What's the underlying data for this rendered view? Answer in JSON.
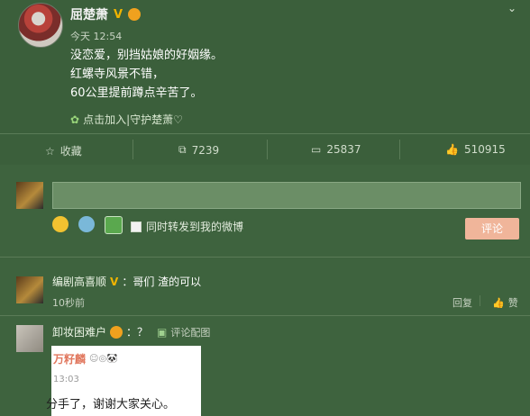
{
  "post": {
    "username": "屈楚萧",
    "verified": "V",
    "time": "今天 12:54",
    "lines": [
      "没恋爱，别挡姑娘的好姻缘。",
      "红螺寺风景不错，",
      "60公里提前蹲点辛苦了。"
    ],
    "guard_link": "点击加入|守护楚萧♡"
  },
  "actions": {
    "favorite": "收藏",
    "repost": "7239",
    "comment": "25837",
    "like": "510915"
  },
  "composer": {
    "checkbox_label": "同时转发到我的微博",
    "submit": "评论"
  },
  "comments": [
    {
      "name": "编剧高喜顺",
      "verified": "V",
      "text": "：哥们 渣的可以",
      "time": "10秒前",
      "reply": "回复",
      "like": "赞"
    },
    {
      "name": "卸妆困难户",
      "text": "：？",
      "view_image": "评论配图"
    }
  ],
  "quoted_image": {
    "name": "万籽麟",
    "time": "13:03",
    "text": "分手了，谢谢大家关心。"
  },
  "colors": {
    "background": "#3b5f3b",
    "submit": "#f0b59a",
    "verified": "#f0b400"
  }
}
